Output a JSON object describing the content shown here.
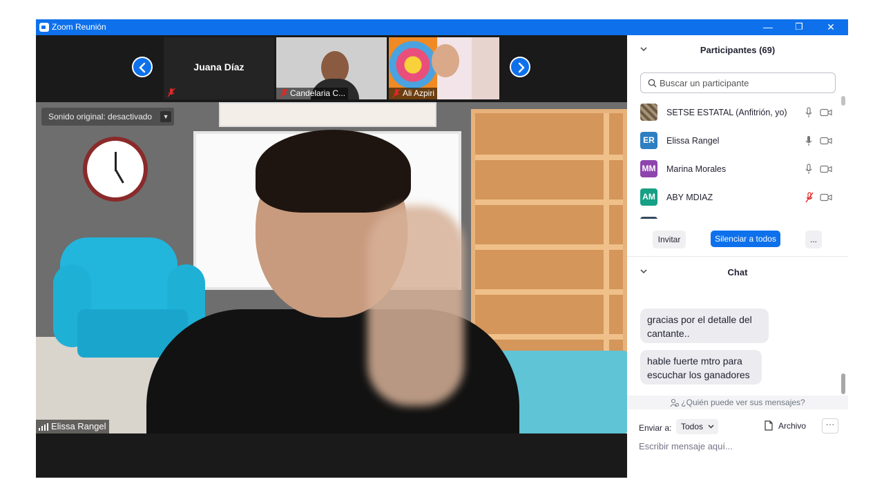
{
  "window": {
    "title": "Zoom Reunión",
    "minimize": "—",
    "restore": "❐",
    "close": "✕"
  },
  "gallery": {
    "tiles": [
      {
        "name": "Juana Díaz",
        "mic": "muted"
      },
      {
        "name": "Candelaria C...",
        "mic": "muted"
      },
      {
        "name": "Ali Azpiri",
        "mic": "muted"
      }
    ]
  },
  "main_video": {
    "original_sound": "Sonido original: desactivado",
    "caret": "▼",
    "speaker_name": "Elissa Rangel"
  },
  "participants": {
    "title": "Participantes (69)",
    "search_placeholder": "Buscar un participante",
    "list": [
      {
        "initials": "",
        "name": "SETSE ESTATAL (Anfitrión, yo)",
        "color": "#6b5b45",
        "mic": "on"
      },
      {
        "initials": "ER",
        "name": "Elissa Rangel",
        "color": "#2d7fc1",
        "mic": "on"
      },
      {
        "initials": "MM",
        "name": "Marina Morales",
        "color": "#8e44ad",
        "mic": "on"
      },
      {
        "initials": "AM",
        "name": "ABY MDIAZ",
        "color": "#16a085",
        "mic": "muted"
      }
    ],
    "invite": "Invitar",
    "mute_all": "Silenciar a todos",
    "more": "..."
  },
  "chat": {
    "title": "Chat",
    "messages": [
      {
        "text_line1": "gracias por el detalle del",
        "text_line2": "cantante.."
      },
      {
        "text_line1": "hable fuerte mtro para",
        "text_line2": "escuchar los ganadores"
      }
    ],
    "who_sees": "¿Quién puede ver sus mensajes?",
    "send_to_label": "Enviar a:",
    "send_to_value": "Todos",
    "file_label": "Archivo",
    "more": "···",
    "input_placeholder": "Escribir mensaje aquí..."
  },
  "colors": {
    "accent": "#0e71eb",
    "muted_red": "#e02828"
  }
}
